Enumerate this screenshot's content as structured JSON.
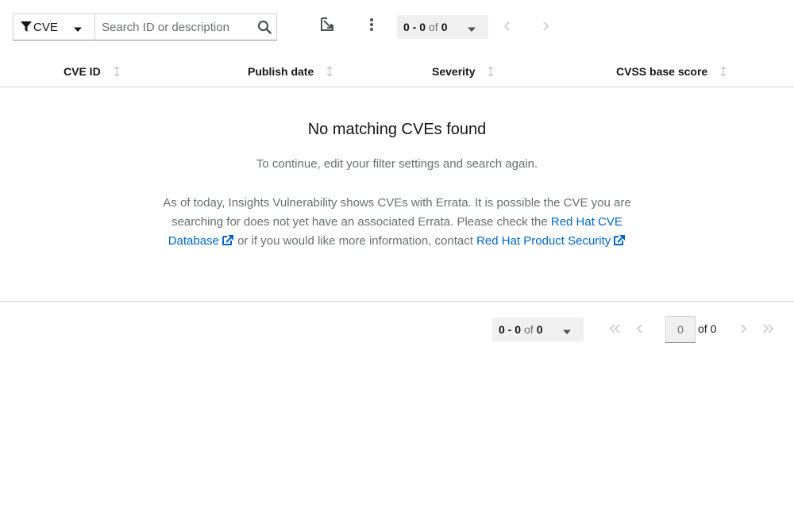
{
  "toolbar": {
    "filter": {
      "label": "CVE",
      "icon": "filter-icon"
    },
    "search": {
      "placeholder": "Search ID or description",
      "value": "",
      "icon": "search-icon"
    },
    "export_icon": "export-icon",
    "kebab_icon": "kebab-icon",
    "pagination": {
      "range": "0 - 0",
      "of_label": "of",
      "total": "0"
    }
  },
  "table": {
    "columns": [
      {
        "label": "CVE ID"
      },
      {
        "label": "Publish date"
      },
      {
        "label": "Severity"
      },
      {
        "label": "CVSS base score"
      }
    ]
  },
  "empty_state": {
    "title": "No matching CVEs found",
    "body": "To continue, edit your filter settings and search again.",
    "info_text_1": "As of today, Insights Vulnerability shows CVEs with Errata. It is possible the CVE you are searching for does not yet have an associated Errata. Please check the ",
    "link_1": "Red Hat CVE Database",
    "info_text_2": " or if you would like more information, contact ",
    "link_2": "Red Hat Product Security",
    "link_color": "#0066cc"
  },
  "bottom_pagination": {
    "range": "0 - 0",
    "of_label": "of",
    "total": "0",
    "page_input_value": "0",
    "page_of": "of 0"
  }
}
